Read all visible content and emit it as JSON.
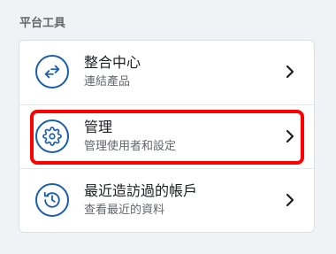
{
  "section": {
    "title": "平台工具"
  },
  "items": [
    {
      "label": "整合中心",
      "sublabel": "連結產品",
      "icon": "swap-arrows-icon"
    },
    {
      "label": "管理",
      "sublabel": "管理使用者和設定",
      "icon": "gear-icon"
    },
    {
      "label": "最近造訪過的帳戶",
      "sublabel": "查看最近的資料",
      "icon": "history-clock-icon"
    }
  ],
  "colors": {
    "icon_accent": "#1c5fa8",
    "highlight": "#ff0000",
    "background": "#f0f2f5"
  }
}
